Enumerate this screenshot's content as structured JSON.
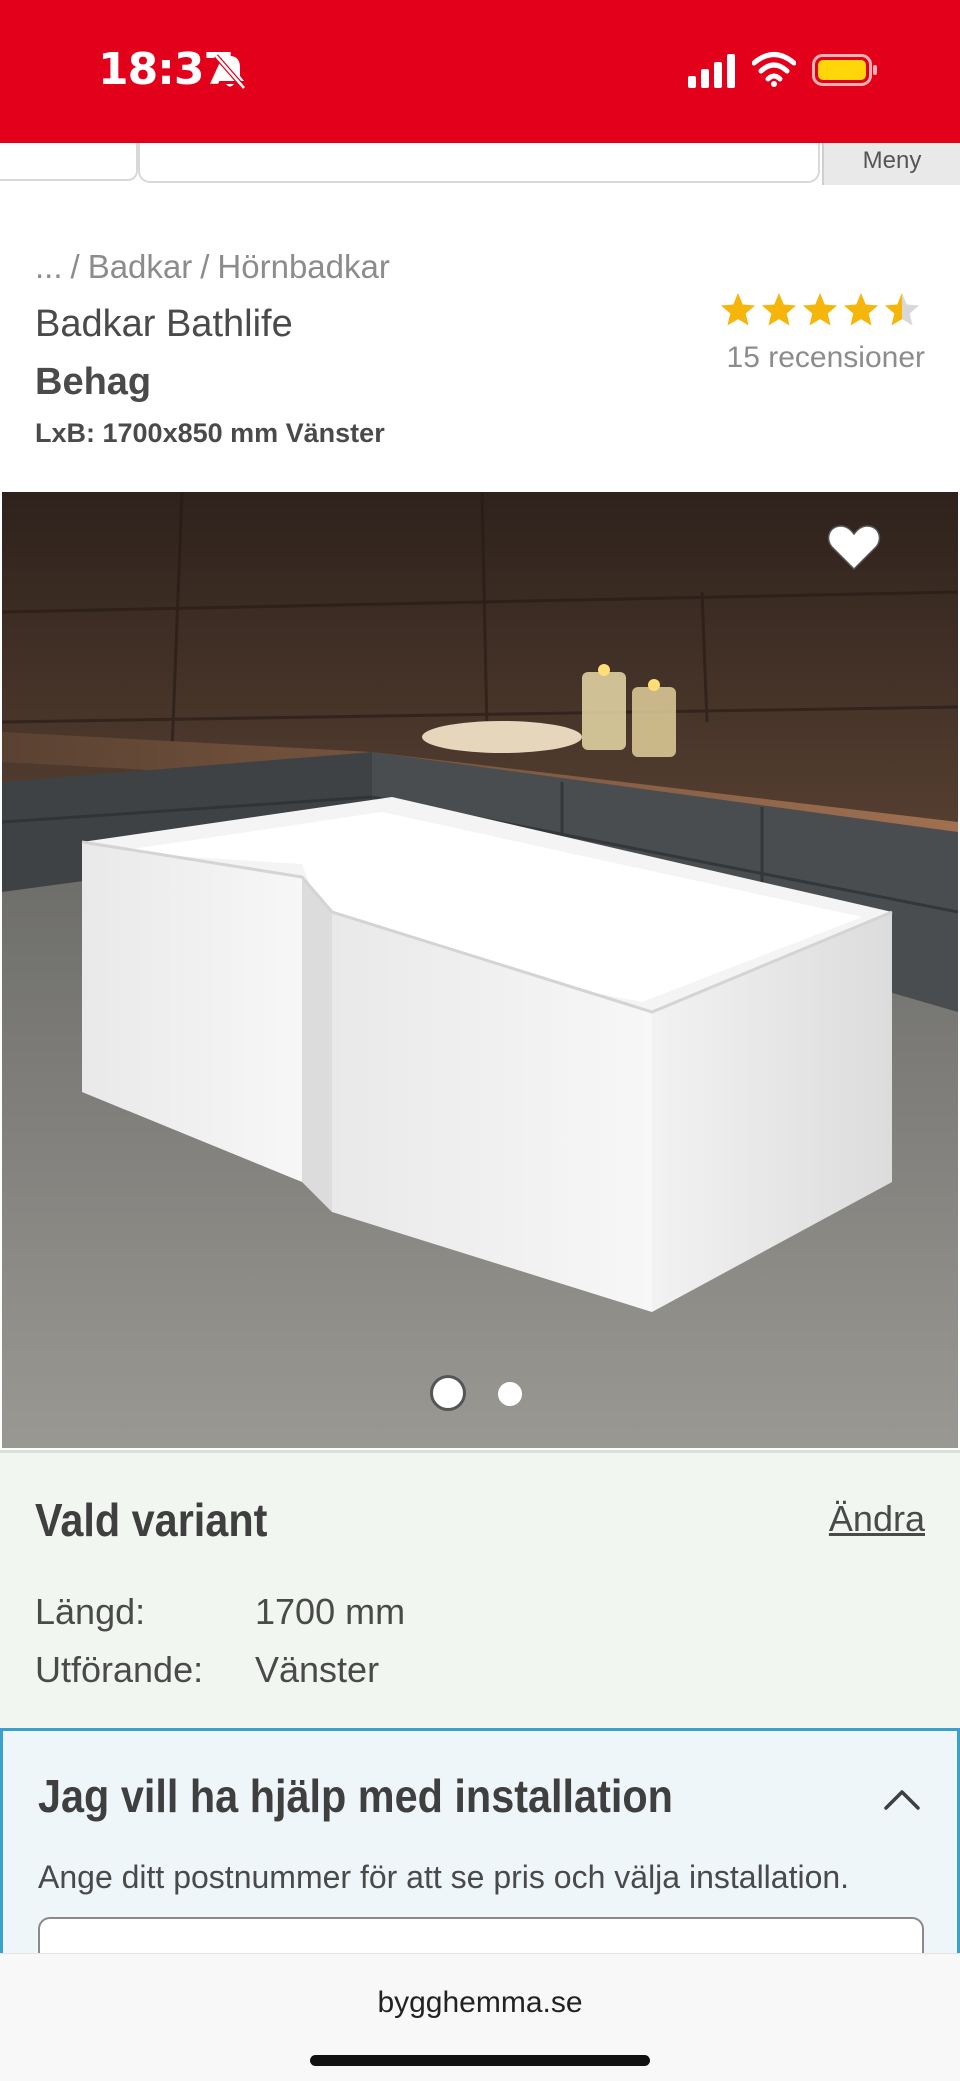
{
  "status_bar": {
    "time": "18:37",
    "icons": [
      "bell-muted-icon",
      "signal-icon",
      "wifi-icon",
      "battery-icon"
    ],
    "background": "#e2001a"
  },
  "nav": {
    "menu_label": "Meny"
  },
  "product": {
    "breadcrumb": [
      "...",
      "/",
      "Badkar",
      "/",
      "Hörnbadkar"
    ],
    "brand": "Badkar Bathlife",
    "name": "Behag",
    "dimensions": "LxB: 1700x850 mm Vänster",
    "rating": 4.5,
    "rating_max": 5,
    "review_count": "15 recensioner",
    "star_color": "#f5b50a"
  },
  "gallery": {
    "image_subject": "white L-shaped corner bathtub in tiled bathroom",
    "slides_total": 2,
    "active_slide": 1
  },
  "variant": {
    "title": "Vald variant",
    "change_label": "Ändra",
    "rows": [
      {
        "label": "Längd:",
        "value": "1700 mm"
      },
      {
        "label": "Utförande:",
        "value": "Vänster"
      }
    ]
  },
  "installation": {
    "title": "Jag vill ha hjälp med installation",
    "description": "Ange ditt postnummer för att se pris och välja installation.",
    "accent": "#3aa0cf"
  },
  "browser": {
    "url": "bygghemma.se"
  }
}
